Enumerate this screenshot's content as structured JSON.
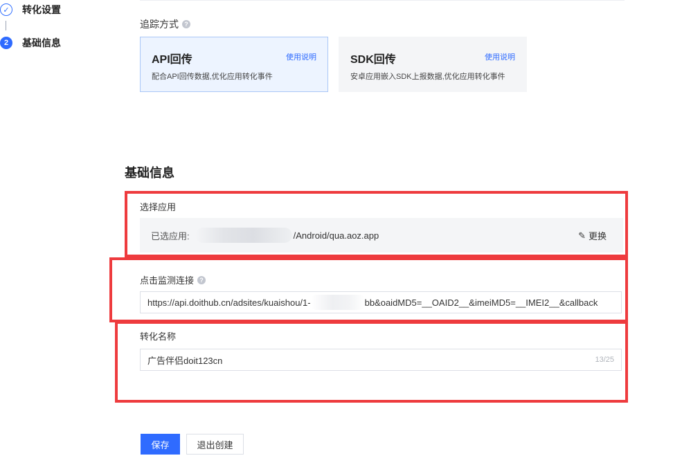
{
  "steps": [
    {
      "label": "转化设置",
      "marker": "✓",
      "state": "done"
    },
    {
      "label": "基础信息",
      "marker": "2",
      "state": "active"
    }
  ],
  "tracking": {
    "label": "追踪方式",
    "help_icon": "question-circle-icon",
    "options": [
      {
        "title": "API回传",
        "link": "使用说明",
        "desc": "配合API回传数据,优化应用转化事件",
        "selected": true
      },
      {
        "title": "SDK回传",
        "link": "使用说明",
        "desc": "安卓应用嵌入SDK上报数据,优化应用转化事件",
        "selected": false
      }
    ]
  },
  "section": {
    "title": "基础信息"
  },
  "app": {
    "label": "选择应用",
    "prefix": "已选应用:",
    "value": "/Android/qua.aoz.app",
    "change_label": "更换",
    "change_icon": "pencil-icon"
  },
  "monitor": {
    "label": "点击监测连接",
    "url_start": "https://api.doithub.cn/adsites/kuaishou/1-",
    "url_end": "bb&oaidMD5=__OAID2__&imeiMD5=__IMEI2__&callback"
  },
  "conversion": {
    "label": "转化名称",
    "value": "广告伴侣doit123cn",
    "count": "13/25"
  },
  "buttons": {
    "save": "保存",
    "exit": "退出创建"
  },
  "colors": {
    "primary": "#2f6bff",
    "highlight": "#ee3b3e",
    "selected_card_bg": "#edf4ff"
  }
}
